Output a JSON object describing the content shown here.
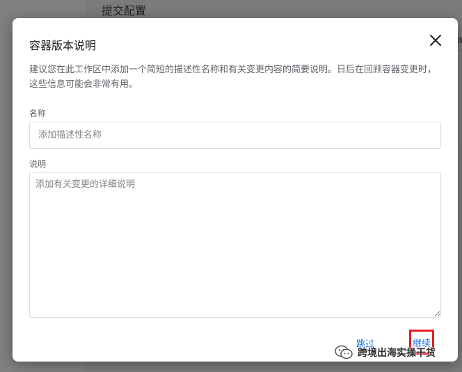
{
  "background": {
    "header_title": "提交配置",
    "right_edge_text": "叫"
  },
  "dialog": {
    "title": "容器版本说明",
    "description": "建议您在此工作区中添加一个简短的描述性名称和有关变更内容的简要说明。日后在回顾容器变更时，这些信息可能会非常有用。",
    "name_label": "名称",
    "name_placeholder": "添加描述性名称",
    "name_value": "",
    "desc_label": "说明",
    "desc_placeholder": "添加有关变更的详细说明",
    "desc_value": "",
    "skip_label": "跳过",
    "continue_label": "继续"
  },
  "watermark": {
    "text": "跨境出海实操干货"
  },
  "colors": {
    "accent": "#1a73e8",
    "highlight_box": "#e51c23",
    "overlay": "#808080"
  },
  "icons": {
    "close": "close-icon",
    "watermark": "wechat-icon"
  }
}
